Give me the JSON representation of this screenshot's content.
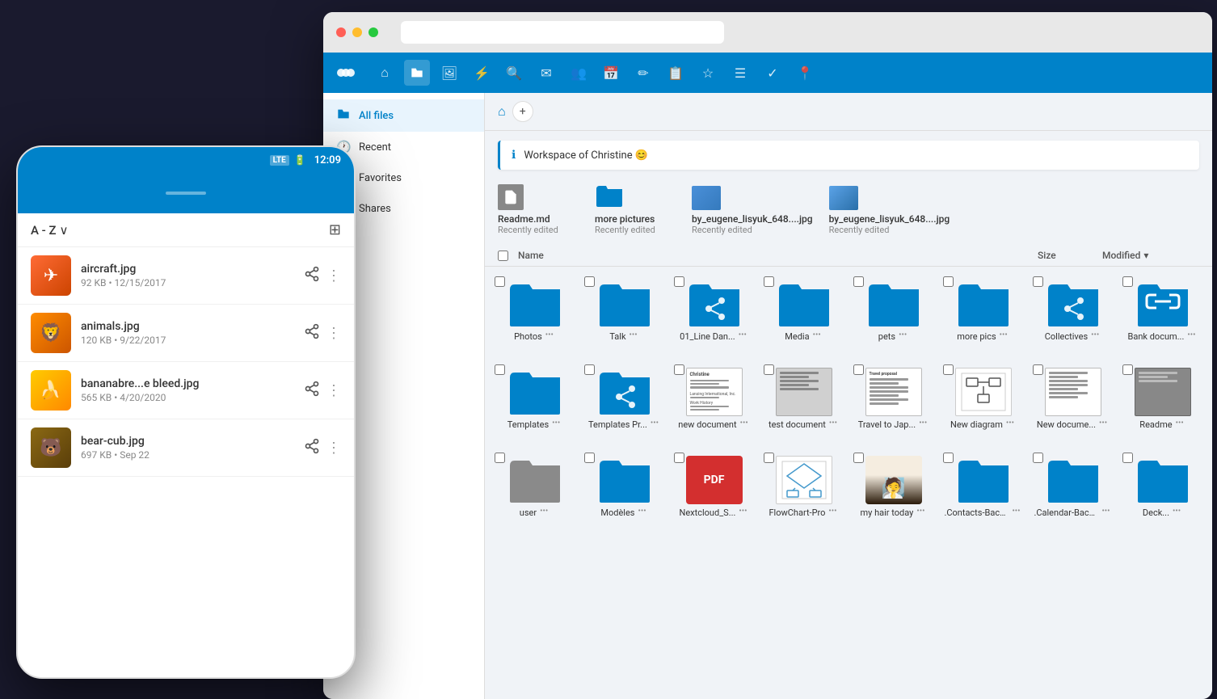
{
  "browser": {
    "dots": [
      "red",
      "yellow",
      "green"
    ]
  },
  "topnav": {
    "icons": [
      {
        "name": "logo",
        "symbol": "⊙⊙⊙"
      },
      {
        "name": "home",
        "symbol": "⌂"
      },
      {
        "name": "files",
        "symbol": "📁",
        "active": true
      },
      {
        "name": "photos",
        "symbol": "🖼"
      },
      {
        "name": "activity",
        "symbol": "⚡"
      },
      {
        "name": "search",
        "symbol": "🔍"
      },
      {
        "name": "mail",
        "symbol": "✉"
      },
      {
        "name": "contacts",
        "symbol": "👥"
      },
      {
        "name": "calendar",
        "symbol": "📅"
      },
      {
        "name": "notes",
        "symbol": "✏"
      },
      {
        "name": "deck",
        "symbol": "📋"
      },
      {
        "name": "starred",
        "symbol": "☆"
      },
      {
        "name": "tasks",
        "symbol": "☰"
      },
      {
        "name": "checkmark",
        "symbol": "✓"
      },
      {
        "name": "maps",
        "symbol": "📍"
      }
    ]
  },
  "sidebar": {
    "items": [
      {
        "id": "all-files",
        "label": "All files",
        "icon": "📁",
        "active": true
      },
      {
        "id": "recent",
        "label": "Recent",
        "icon": "🕐",
        "active": false
      },
      {
        "id": "favorites",
        "label": "Favorites",
        "icon": "★",
        "active": false
      },
      {
        "id": "shares",
        "label": "Shares",
        "icon": "◁",
        "active": false
      }
    ]
  },
  "breadcrumb": {
    "home_icon": "⌂",
    "add_icon": "+"
  },
  "workspace": {
    "message": "Workspace of Christine 😊"
  },
  "recently_edited": {
    "label": "Recently edited",
    "items": [
      {
        "name": "Readme.md",
        "sub": "Recently edited",
        "type": "md"
      },
      {
        "name": "more pictures",
        "sub": "Recently edited",
        "type": "folder"
      },
      {
        "name": "by_eugene_lisyuk_648....jpg",
        "sub": "Recently edited",
        "type": "photo"
      },
      {
        "name": "by_eugene_lisyuk_648....jpg",
        "sub": "Recently edited",
        "type": "photo"
      }
    ]
  },
  "table_header": {
    "col_name": "Name",
    "col_size": "Size",
    "col_modified": "Modified",
    "sort_arrow": "▾"
  },
  "file_grid": {
    "rows": [
      [
        {
          "name": "Photos",
          "type": "folder",
          "shared": false
        },
        {
          "name": "Talk",
          "type": "folder",
          "shared": false
        },
        {
          "name": "01_Line Dan...",
          "type": "folder",
          "shared": true
        },
        {
          "name": "Media",
          "type": "folder",
          "shared": false
        },
        {
          "name": "pets",
          "type": "folder",
          "shared": false
        },
        {
          "name": "more pics",
          "type": "folder",
          "shared": false
        },
        {
          "name": "Collectives",
          "type": "folder",
          "shared": true
        },
        {
          "name": "Bank docum...",
          "type": "folder",
          "link": true
        }
      ],
      [
        {
          "name": "Templates",
          "type": "folder",
          "shared": false
        },
        {
          "name": "Templates Pr...",
          "type": "folder",
          "shared": true
        },
        {
          "name": "new document",
          "type": "doc"
        },
        {
          "name": "test document",
          "type": "doc_grey"
        },
        {
          "name": "Travel to Jap...",
          "type": "doc"
        },
        {
          "name": "New diagram",
          "type": "diagram"
        },
        {
          "name": "New docume...",
          "type": "doc"
        },
        {
          "name": "Readme",
          "type": "md"
        }
      ],
      [
        {
          "name": "user",
          "type": "folder_grey"
        },
        {
          "name": "Modèles",
          "type": "folder"
        },
        {
          "name": "Nextcloud_S...",
          "type": "pdf"
        },
        {
          "name": "FlowChart-Pro",
          "type": "diagram2"
        },
        {
          "name": "my hair today",
          "type": "photo_hair"
        },
        {
          "name": ".Contacts-Backup",
          "type": "folder"
        },
        {
          "name": ".Calendar-Backup",
          "type": "folder"
        },
        {
          "name": "Deck...",
          "type": "folder"
        }
      ]
    ]
  },
  "mobile": {
    "status_bar": {
      "lte": "LTE",
      "battery_icon": "🔋",
      "time": "12:09"
    },
    "sort_label": "A - Z",
    "sort_arrow": "∨",
    "grid_icon": "⊞",
    "files": [
      {
        "name": "aircraft.jpg",
        "meta": "92 KB • 12/15/2017",
        "thumb_type": "aircraft",
        "shared": true
      },
      {
        "name": "animals.jpg",
        "meta": "120 KB • 9/22/2017",
        "thumb_type": "animals",
        "shared": true
      },
      {
        "name": "bananabre...e bleed.jpg",
        "meta": "565 KB • 4/20/2020",
        "thumb_type": "banana",
        "shared": true
      },
      {
        "name": "bear-cub.jpg",
        "meta": "697 KB • Sep 22",
        "thumb_type": "bear",
        "shared": true
      }
    ]
  }
}
